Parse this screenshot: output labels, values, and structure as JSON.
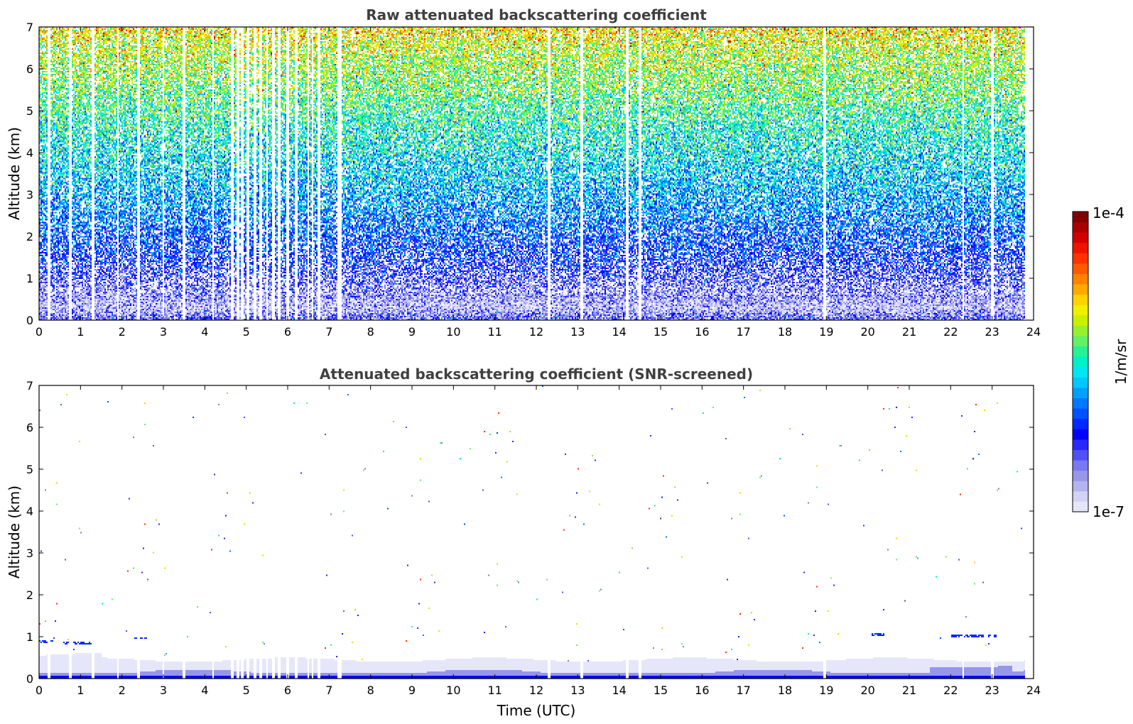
{
  "chart_data": [
    {
      "type": "heatmap",
      "title": "Raw attenuated backscattering coefficient",
      "xlabel": "",
      "ylabel": "Altitude (km)",
      "xlim": [
        0,
        24
      ],
      "ylim": [
        0,
        7
      ],
      "x_ticks": [
        "0",
        "1",
        "2",
        "3",
        "4",
        "5",
        "6",
        "7",
        "8",
        "9",
        "10",
        "11",
        "12",
        "13",
        "14",
        "15",
        "16",
        "17",
        "18",
        "19",
        "20",
        "21",
        "22",
        "23",
        "24"
      ],
      "y_ticks": [
        "0",
        "1",
        "2",
        "3",
        "4",
        "5",
        "6",
        "7"
      ],
      "data_end_time": 23.8,
      "profile": [
        {
          "altitude": 0.05,
          "value": 3e-07
        },
        {
          "altitude": 0.3,
          "value": 1.5e-07
        },
        {
          "altitude": 0.8,
          "value": 3e-07
        },
        {
          "altitude": 1.5,
          "value": 6e-07
        },
        {
          "altitude": 2.5,
          "value": 1.2e-06
        },
        {
          "altitude": 3.5,
          "value": 2e-06
        },
        {
          "altitude": 4.5,
          "value": 3e-06
        },
        {
          "altitude": 5.5,
          "value": 5e-06
        },
        {
          "altitude": 6.5,
          "value": 8e-06
        },
        {
          "altitude": 7.0,
          "value": 1.2e-05
        }
      ],
      "data_gaps_utc": [
        0.25,
        0.75,
        1.3,
        1.9,
        2.4,
        3.0,
        3.5,
        4.2,
        4.65,
        4.8,
        4.9,
        5.05,
        5.2,
        5.35,
        5.5,
        5.65,
        5.8,
        6.0,
        6.2,
        6.5,
        6.6,
        6.75,
        7.22,
        7.28,
        12.3,
        13.1,
        14.2,
        14.5,
        18.95,
        22.3,
        23.0
      ]
    },
    {
      "type": "heatmap",
      "title": "Attenuated backscattering coefficient (SNR-screened)",
      "xlabel": "Time (UTC)",
      "ylabel": "Altitude (km)",
      "xlim": [
        0,
        24
      ],
      "ylim": [
        0,
        7
      ],
      "x_ticks": [
        "0",
        "1",
        "2",
        "3",
        "4",
        "5",
        "6",
        "7",
        "8",
        "9",
        "10",
        "11",
        "12",
        "13",
        "14",
        "15",
        "16",
        "17",
        "18",
        "19",
        "20",
        "21",
        "22",
        "23",
        "24"
      ],
      "y_ticks": [
        "0",
        "1",
        "2",
        "3",
        "4",
        "5",
        "6",
        "7"
      ],
      "data_end_time": 23.8,
      "boundary_layer_top_km": 0.45,
      "layers": [
        {
          "time_start": 0.0,
          "time_end": 0.35,
          "altitude": 0.88,
          "value": 8e-07
        },
        {
          "time_start": 0.6,
          "time_end": 1.3,
          "altitude": 0.84,
          "value": 8e-07
        },
        {
          "time_start": 2.3,
          "time_end": 2.6,
          "altitude": 0.97,
          "value": 7e-07
        },
        {
          "time_start": 20.1,
          "time_end": 20.4,
          "altitude": 1.05,
          "value": 7e-07
        },
        {
          "time_start": 22.0,
          "time_end": 23.1,
          "altitude": 1.02,
          "value": 7e-07
        }
      ]
    }
  ],
  "colorbar": {
    "label": "1/m/sr",
    "max_label": "1e-4",
    "min_label": "1e-7",
    "scale": "log",
    "range": [
      1e-07,
      0.0001
    ],
    "colors": [
      "#e6e6fa",
      "#d2d2f5",
      "#b4b4f0",
      "#9696eb",
      "#7878f0",
      "#5050f5",
      "#2828fa",
      "#0000ff",
      "#0028ff",
      "#0050ff",
      "#0078ff",
      "#00a0ff",
      "#00c8ff",
      "#00e6f0",
      "#00f0c8",
      "#28f096",
      "#64f064",
      "#96f032",
      "#c8f000",
      "#f0f000",
      "#ffd200",
      "#ffaa00",
      "#ff8200",
      "#ff5a00",
      "#ff3200",
      "#f01400",
      "#d20000",
      "#aa0000",
      "#820000"
    ]
  }
}
